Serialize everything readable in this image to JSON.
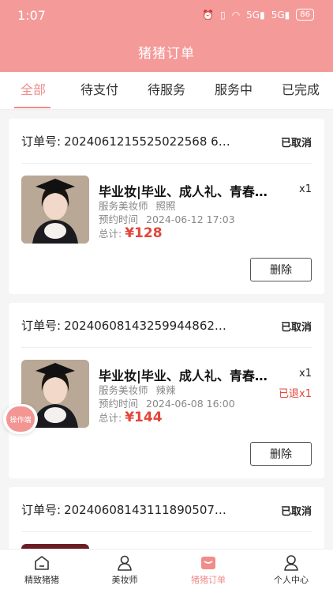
{
  "status_bar": {
    "time": "1:07",
    "signal1": "5G",
    "signal2": "5G",
    "battery": "86"
  },
  "header": {
    "title": "猪猪订单"
  },
  "tabs": [
    {
      "label": "全部",
      "active": true
    },
    {
      "label": "待支付"
    },
    {
      "label": "待服务"
    },
    {
      "label": "服务中"
    },
    {
      "label": "已完成"
    }
  ],
  "labels": {
    "order_no": "订单号:",
    "artist": "服务美妆师",
    "appointment": "预约时间",
    "total": "总计:",
    "delete": "删除"
  },
  "orders": [
    {
      "order_no": "2024061215525022568 6…",
      "status": "已取消",
      "product": "毕业妆|毕业、成人礼、青春…",
      "qty": "x1",
      "artist": "照照",
      "time": "2024-06-12 17:03",
      "price": "¥128"
    },
    {
      "order_no": "20240608143259944862…",
      "status": "已取消",
      "product": "毕业妆|毕业、成人礼、青春…",
      "qty": "x1",
      "refund": "已退x1",
      "artist": "辣辣",
      "time": "2024-06-08 16:00",
      "price": "¥144"
    },
    {
      "order_no": "20240608143111890507…",
      "status": "已取消"
    }
  ],
  "float_button": "操作端",
  "tabbar": [
    {
      "label": "精致猪猪",
      "icon": "home-icon"
    },
    {
      "label": "美妆师",
      "icon": "person-icon"
    },
    {
      "label": "猪猪订单",
      "icon": "order-icon",
      "active": true
    },
    {
      "label": "个人中心",
      "icon": "profile-icon"
    }
  ],
  "colors": {
    "header": "#f49a99",
    "accent": "#f08d8b",
    "price": "#e3453a"
  }
}
